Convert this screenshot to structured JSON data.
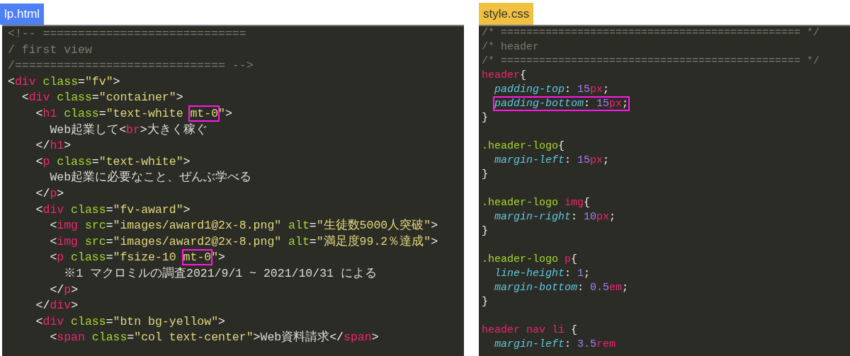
{
  "editors": [
    {
      "file_tab": {
        "label": "lp.html",
        "kind": "html"
      },
      "lines": [
        {
          "kind": "code",
          "tokens": [
            {
              "kind": "comment",
              "text": "<!-- ============================="
            }
          ]
        },
        {
          "kind": "code",
          "tokens": [
            {
              "kind": "comment",
              "text": "/ first view"
            }
          ]
        },
        {
          "kind": "code",
          "tokens": [
            {
              "kind": "comment",
              "text": "/============================== -->"
            }
          ]
        },
        {
          "kind": "code",
          "tokens": [
            {
              "kind": "punct",
              "text": "<"
            },
            {
              "kind": "tag",
              "text": "div"
            },
            {
              "kind": "attr",
              "text": " class"
            },
            {
              "kind": "punct",
              "text": "="
            },
            {
              "kind": "string",
              "text": "\"fv\""
            },
            {
              "kind": "punct",
              "text": ">"
            }
          ],
          "children": [
            {
              "kind": "code",
              "tokens": [
                {
                  "kind": "punct",
                  "text": "<"
                },
                {
                  "kind": "tag",
                  "text": "div"
                },
                {
                  "kind": "attr",
                  "text": " class"
                },
                {
                  "kind": "punct",
                  "text": "="
                },
                {
                  "kind": "string",
                  "text": "\"container\""
                },
                {
                  "kind": "punct",
                  "text": ">"
                }
              ],
              "children": [
                {
                  "kind": "code",
                  "tokens": [
                    {
                      "kind": "punct",
                      "text": "<"
                    },
                    {
                      "kind": "tag",
                      "text": "h1"
                    },
                    {
                      "kind": "attr",
                      "text": " class"
                    },
                    {
                      "kind": "punct",
                      "text": "="
                    },
                    {
                      "kind": "string",
                      "text": "\"text-white "
                    },
                    {
                      "kind": "marked",
                      "tokens": [
                        {
                          "kind": "string",
                          "text": "mt-0"
                        }
                      ]
                    },
                    {
                      "kind": "string",
                      "text": "\""
                    },
                    {
                      "kind": "punct",
                      "text": ">"
                    }
                  ],
                  "children": [
                    {
                      "kind": "code",
                      "tokens": [
                        {
                          "kind": "text",
                          "text": "Web起業して"
                        },
                        {
                          "kind": "punct",
                          "text": "<"
                        },
                        {
                          "kind": "tag",
                          "text": "br"
                        },
                        {
                          "kind": "punct",
                          "text": ">"
                        },
                        {
                          "kind": "text",
                          "text": "大きく稼ぐ"
                        }
                      ]
                    }
                  ]
                },
                {
                  "kind": "code",
                  "tokens": [
                    {
                      "kind": "punct",
                      "text": "</"
                    },
                    {
                      "kind": "tag",
                      "text": "h1"
                    },
                    {
                      "kind": "punct",
                      "text": ">"
                    }
                  ]
                },
                {
                  "kind": "code",
                  "tokens": [
                    {
                      "kind": "punct",
                      "text": "<"
                    },
                    {
                      "kind": "tag",
                      "text": "p"
                    },
                    {
                      "kind": "attr",
                      "text": " class"
                    },
                    {
                      "kind": "punct",
                      "text": "="
                    },
                    {
                      "kind": "string",
                      "text": "\"text-white\""
                    },
                    {
                      "kind": "punct",
                      "text": ">"
                    }
                  ],
                  "children": [
                    {
                      "kind": "code",
                      "tokens": [
                        {
                          "kind": "text",
                          "text": "Web起業に必要なこと、ぜんぶ学べる"
                        }
                      ]
                    }
                  ]
                },
                {
                  "kind": "code",
                  "tokens": [
                    {
                      "kind": "punct",
                      "text": "</"
                    },
                    {
                      "kind": "tag",
                      "text": "p"
                    },
                    {
                      "kind": "punct",
                      "text": ">"
                    }
                  ]
                },
                {
                  "kind": "code",
                  "tokens": [
                    {
                      "kind": "punct",
                      "text": "<"
                    },
                    {
                      "kind": "tag",
                      "text": "div"
                    },
                    {
                      "kind": "attr",
                      "text": " class"
                    },
                    {
                      "kind": "punct",
                      "text": "="
                    },
                    {
                      "kind": "string",
                      "text": "\"fv-award\""
                    },
                    {
                      "kind": "punct",
                      "text": ">"
                    }
                  ],
                  "children": [
                    {
                      "kind": "code",
                      "tokens": [
                        {
                          "kind": "punct",
                          "text": "<"
                        },
                        {
                          "kind": "tag",
                          "text": "img"
                        },
                        {
                          "kind": "attr",
                          "text": " src"
                        },
                        {
                          "kind": "punct",
                          "text": "="
                        },
                        {
                          "kind": "string",
                          "text": "\"images/award1@2x-8.png\""
                        },
                        {
                          "kind": "attr",
                          "text": " alt"
                        },
                        {
                          "kind": "punct",
                          "text": "="
                        },
                        {
                          "kind": "string",
                          "text": "\"生徒数5000人突破\""
                        },
                        {
                          "kind": "punct",
                          "text": ">"
                        }
                      ]
                    },
                    {
                      "kind": "code",
                      "tokens": [
                        {
                          "kind": "punct",
                          "text": "<"
                        },
                        {
                          "kind": "tag",
                          "text": "img"
                        },
                        {
                          "kind": "attr",
                          "text": " src"
                        },
                        {
                          "kind": "punct",
                          "text": "="
                        },
                        {
                          "kind": "string",
                          "text": "\"images/award2@2x-8.png\""
                        },
                        {
                          "kind": "attr",
                          "text": " alt"
                        },
                        {
                          "kind": "punct",
                          "text": "="
                        },
                        {
                          "kind": "string",
                          "text": "\"満足度99.2％達成\""
                        },
                        {
                          "kind": "punct",
                          "text": ">"
                        }
                      ]
                    },
                    {
                      "kind": "code",
                      "tokens": [
                        {
                          "kind": "punct",
                          "text": "<"
                        },
                        {
                          "kind": "tag",
                          "text": "p"
                        },
                        {
                          "kind": "attr",
                          "text": " class"
                        },
                        {
                          "kind": "punct",
                          "text": "="
                        },
                        {
                          "kind": "string",
                          "text": "\"fsize-10 "
                        },
                        {
                          "kind": "marked",
                          "tokens": [
                            {
                              "kind": "string",
                              "text": "mt-0"
                            }
                          ]
                        },
                        {
                          "kind": "string",
                          "text": "\""
                        },
                        {
                          "kind": "punct",
                          "text": ">"
                        }
                      ],
                      "children": [
                        {
                          "kind": "code",
                          "tokens": [
                            {
                              "kind": "text",
                              "text": "※1 マクロミルの調査2021/9/1 ~ 2021/10/31 による"
                            }
                          ]
                        }
                      ]
                    },
                    {
                      "kind": "code",
                      "tokens": [
                        {
                          "kind": "punct",
                          "text": "</"
                        },
                        {
                          "kind": "tag",
                          "text": "p"
                        },
                        {
                          "kind": "punct",
                          "text": ">"
                        }
                      ]
                    }
                  ]
                },
                {
                  "kind": "code",
                  "tokens": [
                    {
                      "kind": "punct",
                      "text": "</"
                    },
                    {
                      "kind": "tag",
                      "text": "div"
                    },
                    {
                      "kind": "punct",
                      "text": ">"
                    }
                  ]
                },
                {
                  "kind": "code",
                  "tokens": [
                    {
                      "kind": "punct",
                      "text": "<"
                    },
                    {
                      "kind": "tag",
                      "text": "div"
                    },
                    {
                      "kind": "attr",
                      "text": " class"
                    },
                    {
                      "kind": "punct",
                      "text": "="
                    },
                    {
                      "kind": "string",
                      "text": "\"btn bg-yellow\""
                    },
                    {
                      "kind": "punct",
                      "text": ">"
                    }
                  ],
                  "children": [
                    {
                      "kind": "code",
                      "tokens": [
                        {
                          "kind": "punct",
                          "text": "<"
                        },
                        {
                          "kind": "tag",
                          "text": "span"
                        },
                        {
                          "kind": "attr",
                          "text": " class"
                        },
                        {
                          "kind": "punct",
                          "text": "="
                        },
                        {
                          "kind": "string",
                          "text": "\"col text-center\""
                        },
                        {
                          "kind": "punct",
                          "text": ">"
                        },
                        {
                          "kind": "text",
                          "text": "Web資料請求"
                        },
                        {
                          "kind": "punct",
                          "text": "</"
                        },
                        {
                          "kind": "tag",
                          "text": "span"
                        },
                        {
                          "kind": "punct",
                          "text": ">"
                        }
                      ]
                    }
                  ]
                }
              ]
            }
          ]
        }
      ]
    },
    {
      "file_tab": {
        "label": "style.css",
        "kind": "css"
      },
      "lines": [
        {
          "kind": "code",
          "tokens": [
            {
              "kind": "comment",
              "text": "/* =============================================== */"
            }
          ]
        },
        {
          "kind": "code",
          "tokens": [
            {
              "kind": "comment",
              "text": "/* header"
            }
          ]
        },
        {
          "kind": "code",
          "tokens": [
            {
              "kind": "comment",
              "text": "/* =============================================== */"
            }
          ]
        },
        {
          "kind": "code",
          "tokens": [
            {
              "kind": "tag",
              "text": "header"
            },
            {
              "kind": "punct",
              "text": "{"
            }
          ],
          "children": [
            {
              "kind": "code",
              "tokens": [
                {
                  "kind": "prop",
                  "text": "padding-top"
                },
                {
                  "kind": "punct",
                  "text": ": "
                },
                {
                  "kind": "number",
                  "text": "15"
                },
                {
                  "kind": "tag",
                  "text": "px"
                },
                {
                  "kind": "punct",
                  "text": ";"
                }
              ]
            },
            {
              "kind": "code",
              "tokens": [
                {
                  "kind": "marked",
                  "tokens": [
                    {
                      "kind": "prop",
                      "text": "padding-bottom"
                    },
                    {
                      "kind": "punct",
                      "text": ": "
                    },
                    {
                      "kind": "number",
                      "text": "15"
                    },
                    {
                      "kind": "tag",
                      "text": "px"
                    },
                    {
                      "kind": "punct",
                      "text": ";"
                    }
                  ]
                }
              ]
            }
          ]
        },
        {
          "kind": "code",
          "tokens": [
            {
              "kind": "punct",
              "text": "}"
            }
          ]
        },
        {
          "kind": "blank"
        },
        {
          "kind": "code",
          "tokens": [
            {
              "kind": "attr",
              "text": ".header-logo"
            },
            {
              "kind": "punct",
              "text": "{"
            }
          ],
          "children": [
            {
              "kind": "code",
              "tokens": [
                {
                  "kind": "prop",
                  "text": "margin-left"
                },
                {
                  "kind": "punct",
                  "text": ": "
                },
                {
                  "kind": "number",
                  "text": "15"
                },
                {
                  "kind": "tag",
                  "text": "px"
                },
                {
                  "kind": "punct",
                  "text": ";"
                }
              ]
            }
          ]
        },
        {
          "kind": "code",
          "tokens": [
            {
              "kind": "punct",
              "text": "}"
            }
          ]
        },
        {
          "kind": "blank"
        },
        {
          "kind": "code",
          "tokens": [
            {
              "kind": "attr",
              "text": ".header-logo "
            },
            {
              "kind": "tag",
              "text": "img"
            },
            {
              "kind": "punct",
              "text": "{"
            }
          ],
          "children": [
            {
              "kind": "code",
              "tokens": [
                {
                  "kind": "prop",
                  "text": "margin-right"
                },
                {
                  "kind": "punct",
                  "text": ": "
                },
                {
                  "kind": "number",
                  "text": "10"
                },
                {
                  "kind": "tag",
                  "text": "px"
                },
                {
                  "kind": "punct",
                  "text": ";"
                }
              ]
            }
          ]
        },
        {
          "kind": "code",
          "tokens": [
            {
              "kind": "punct",
              "text": "}"
            }
          ]
        },
        {
          "kind": "blank"
        },
        {
          "kind": "code",
          "tokens": [
            {
              "kind": "attr",
              "text": ".header-logo "
            },
            {
              "kind": "tag",
              "text": "p"
            },
            {
              "kind": "punct",
              "text": "{"
            }
          ],
          "children": [
            {
              "kind": "code",
              "tokens": [
                {
                  "kind": "prop",
                  "text": "line-height"
                },
                {
                  "kind": "punct",
                  "text": ": "
                },
                {
                  "kind": "number",
                  "text": "1"
                },
                {
                  "kind": "punct",
                  "text": ";"
                }
              ]
            },
            {
              "kind": "code",
              "tokens": [
                {
                  "kind": "prop",
                  "text": "margin-bottom"
                },
                {
                  "kind": "punct",
                  "text": ": "
                },
                {
                  "kind": "number",
                  "text": "0.5"
                },
                {
                  "kind": "tag",
                  "text": "em"
                },
                {
                  "kind": "punct",
                  "text": ";"
                }
              ]
            }
          ]
        },
        {
          "kind": "code",
          "tokens": [
            {
              "kind": "punct",
              "text": "}"
            }
          ]
        },
        {
          "kind": "blank"
        },
        {
          "kind": "code",
          "tokens": [
            {
              "kind": "tag",
              "text": "header nav li "
            },
            {
              "kind": "punct",
              "text": "{"
            }
          ],
          "children": [
            {
              "kind": "code",
              "tokens": [
                {
                  "kind": "prop",
                  "text": "margin-left"
                },
                {
                  "kind": "punct",
                  "text": ": "
                },
                {
                  "kind": "number",
                  "text": "3.5"
                },
                {
                  "kind": "tag",
                  "text": "rem"
                }
              ]
            }
          ]
        }
      ]
    }
  ]
}
